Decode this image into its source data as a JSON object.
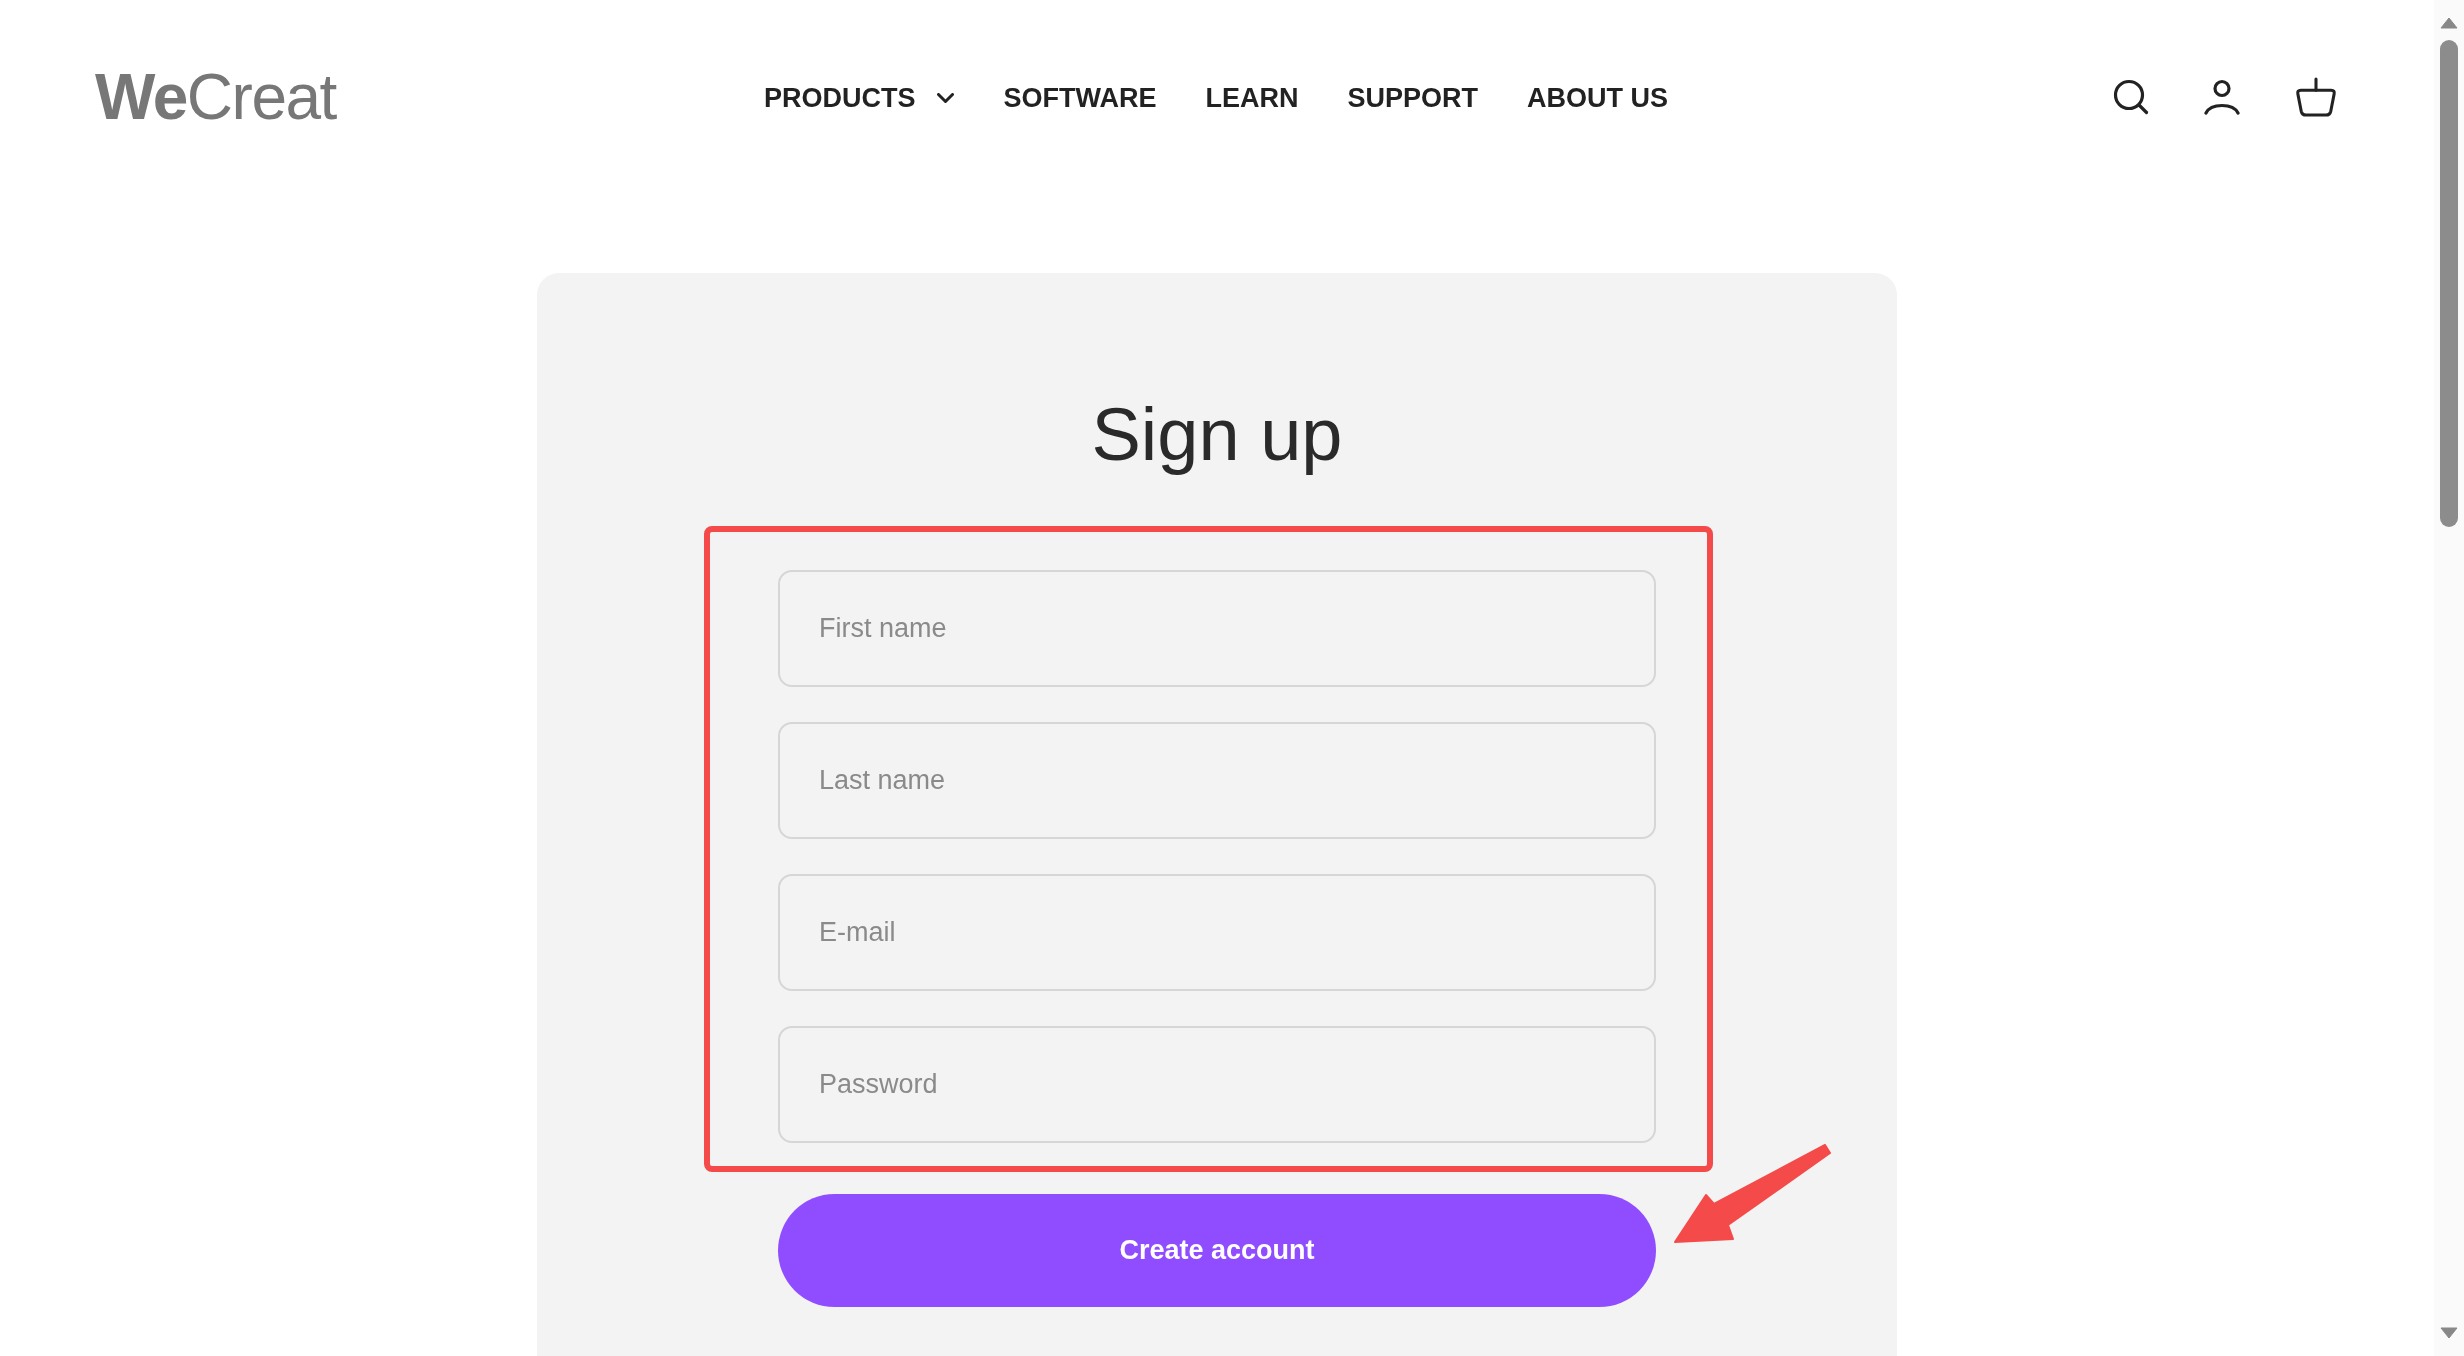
{
  "header": {
    "logo": "**We**Creat",
    "nav": [
      {
        "label": "PRODUCTS",
        "has_menu": true
      },
      {
        "label": "SOFTWARE",
        "has_menu": false
      },
      {
        "label": "LEARN",
        "has_menu": false
      },
      {
        "label": "SUPPORT",
        "has_menu": false
      },
      {
        "label": "ABOUT US",
        "has_menu": false
      }
    ]
  },
  "signup": {
    "title": "Sign up",
    "fields": [
      {
        "placeholder": "First name"
      },
      {
        "placeholder": "Last name"
      },
      {
        "placeholder": "E-mail"
      },
      {
        "placeholder": "Password"
      }
    ],
    "submit": "Create account"
  }
}
